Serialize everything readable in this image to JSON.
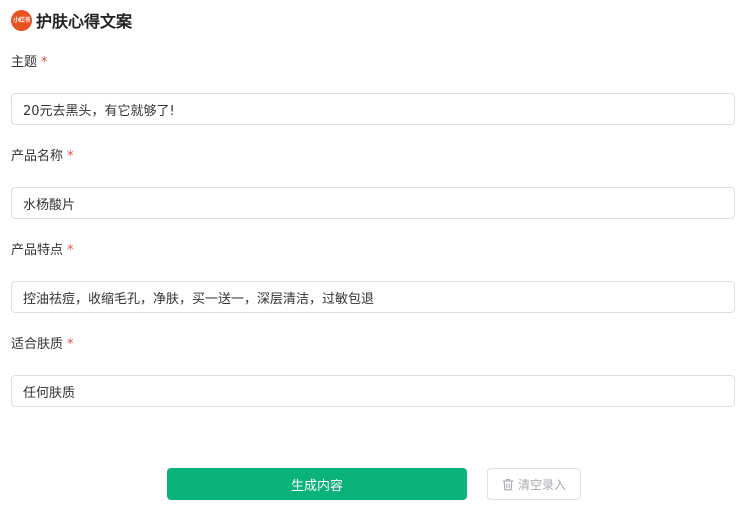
{
  "header": {
    "logo_text": "小红书",
    "title": "护肤心得文案"
  },
  "form": {
    "required_mark": "*",
    "fields": [
      {
        "label": "主题",
        "value": "20元去黑头，有它就够了!"
      },
      {
        "label": "产品名称",
        "value": "水杨酸片"
      },
      {
        "label": "产品特点",
        "value": "控油祛痘，收缩毛孔，净肤，买一送一，深层清洁，过敏包退"
      },
      {
        "label": "适合肤质",
        "value": "任何肤质"
      }
    ]
  },
  "actions": {
    "generate_label": "生成内容",
    "clear_label": "清空录入",
    "clear_icon": "trash-icon"
  },
  "colors": {
    "accent": "#0bb37a",
    "required": "#e54d42",
    "logo": "#e8521f"
  }
}
